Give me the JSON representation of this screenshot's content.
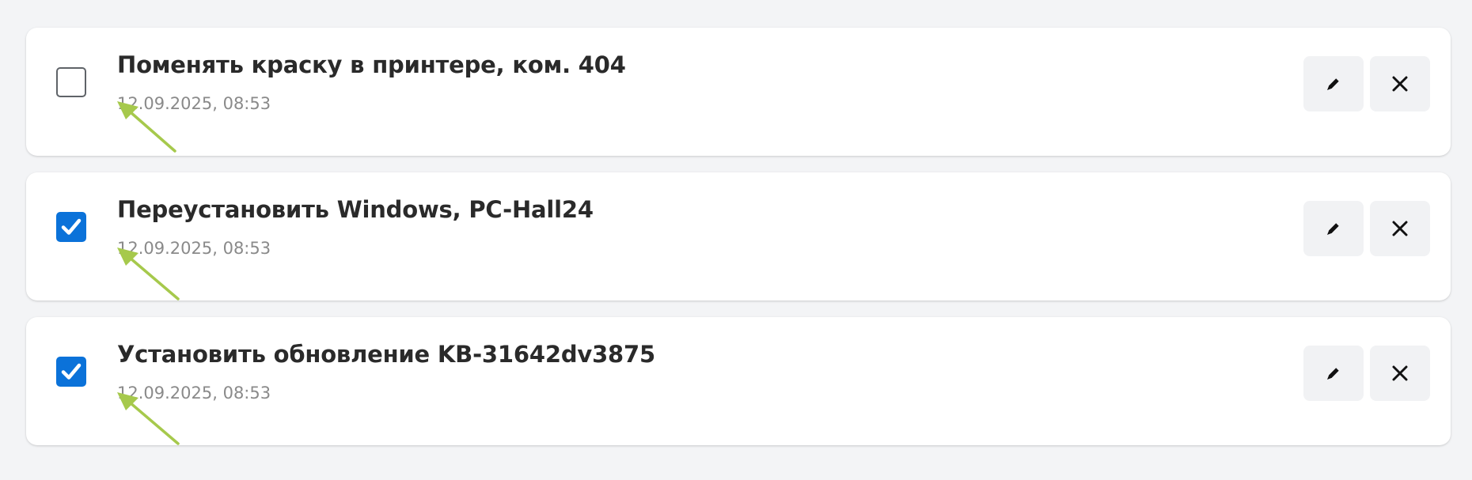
{
  "tasks": [
    {
      "title": "Поменять краску в принтере, ком. 404",
      "date": "12.09.2025, 08:53",
      "completed": false
    },
    {
      "title": "Переустановить Windows, PC-Hall24",
      "date": "12.09.2025, 08:53",
      "completed": true
    },
    {
      "title": "Установить обновление KB-31642dv3875",
      "date": "12.09.2025, 08:53",
      "completed": true
    }
  ],
  "icons": {
    "edit": "pencil-icon",
    "delete": "close-icon",
    "annotation": "arrow-annotation-icon"
  },
  "colors": {
    "checkbox_checked": "#0b72d9",
    "annotation_arrow": "#a6c94c",
    "page_background": "#f3f4f6"
  }
}
